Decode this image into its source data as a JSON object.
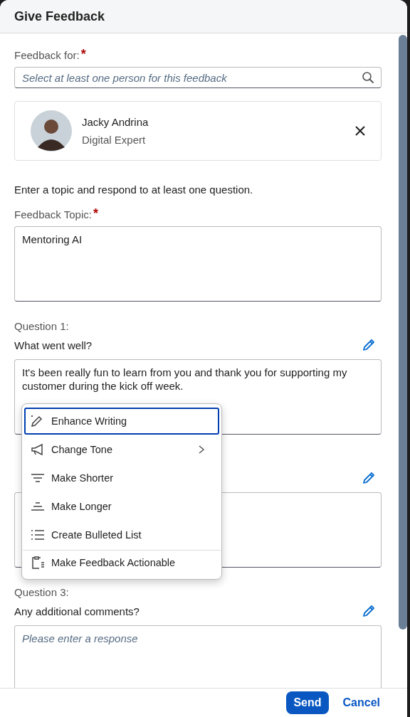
{
  "dialog": {
    "title": "Give Feedback"
  },
  "feedback_for": {
    "label": "Feedback for:",
    "required_mark": "*",
    "placeholder": "Select at least one person for this feedback"
  },
  "person": {
    "name": "Jacky Andrina",
    "role": "Digital Expert"
  },
  "instruction": "Enter a topic and respond to at least one question.",
  "topic": {
    "label": "Feedback Topic:",
    "required_mark": "*",
    "value": "Mentoring AI"
  },
  "questions": [
    {
      "kind": "open",
      "label": "Question 1:",
      "text": "What went well?",
      "value": "It's been really fun to learn from you and thank you for supporting my customer during the kick off week."
    },
    {
      "kind": "covered"
    },
    {
      "kind": "open",
      "label": "Question 3:",
      "text": "Any additional comments?",
      "placeholder": "Please enter a response"
    }
  ],
  "menu": {
    "items": [
      {
        "kind": "enhance",
        "label": "Enhance Writing",
        "selected": true,
        "submenu": false,
        "separator": false
      },
      {
        "kind": "tone",
        "label": "Change Tone",
        "selected": false,
        "submenu": true,
        "separator": false
      },
      {
        "kind": "shorter",
        "label": "Make Shorter",
        "selected": false,
        "submenu": false,
        "separator": false
      },
      {
        "kind": "longer",
        "label": "Make Longer",
        "selected": false,
        "submenu": false,
        "separator": false
      },
      {
        "kind": "bullets",
        "label": "Create Bulleted List",
        "selected": false,
        "submenu": false,
        "separator": false
      },
      {
        "kind": "actionable",
        "label": "Make Feedback Actionable",
        "selected": false,
        "submenu": false,
        "separator": true
      }
    ]
  },
  "footer": {
    "buttons": [
      {
        "kind": "primary",
        "label": "Send"
      },
      {
        "kind": "link",
        "label": "Cancel"
      }
    ]
  }
}
